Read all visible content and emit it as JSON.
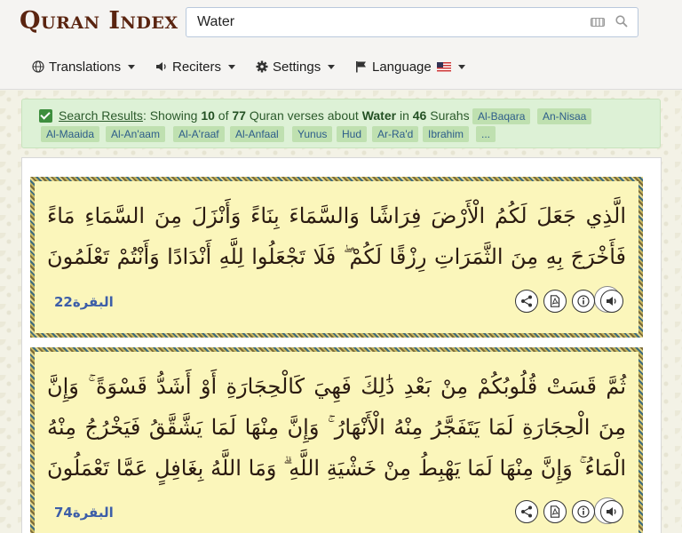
{
  "app": {
    "logo_text": "Quran Index"
  },
  "search": {
    "value": "Water"
  },
  "menu": {
    "translations": "Translations",
    "reciters": "Reciters",
    "settings": "Settings",
    "language": "Language"
  },
  "results": {
    "link_label": "Search Results",
    "prefix": ": Showing ",
    "shown": "10",
    "of": " of ",
    "total": "77",
    "mid": " Quran verses about ",
    "term": "Water",
    "in": " in ",
    "surah_count": "46",
    "suffix": " Surahs",
    "tags": [
      "Al-Baqara",
      "An-Nisaa",
      "Al-Maaida",
      "Al-An'aam",
      "Al-A'raaf",
      "Al-Anfaal",
      "Yunus",
      "Hud",
      "Ar-Ra'd",
      "Ibrahim",
      "..."
    ]
  },
  "verses": [
    {
      "text": "الَّذِي جَعَلَ لَكُمُ الْأَرْضَ فِرَاشًا وَالسَّمَاءَ بِنَاءً وَأَنْزَلَ مِنَ السَّمَاءِ مَاءً فَأَخْرَجَ بِهِ مِنَ الثَّمَرَاتِ رِزْقًا لَكُمْ ۖ فَلَا تَجْعَلُوا لِلَّهِ أَنْدَادًا وَأَنْتُمْ تَعْلَمُونَ",
      "number": "22",
      "surah": "البقرة",
      "ref_number": "22"
    },
    {
      "text": "ثُمَّ قَسَتْ قُلُوبُكُمْ مِنْ بَعْدِ ذَٰلِكَ فَهِيَ كَالْحِجَارَةِ أَوْ أَشَدُّ قَسْوَةً ۚ وَإِنَّ مِنَ الْحِجَارَةِ لَمَا يَتَفَجَّرُ مِنْهُ الْأَنْهَارُ ۚ وَإِنَّ مِنْهَا لَمَا يَشَّقَّقُ فَيَخْرُجُ مِنْهُ الْمَاءُ ۚ وَإِنَّ مِنْهَا لَمَا يَهْبِطُ مِنْ خَشْيَةِ اللَّهِ ۗ وَمَا اللَّهُ بِغَافِلٍ عَمَّا تَعْمَلُونَ",
      "number": "74",
      "surah": "البقرة",
      "ref_number": "74"
    }
  ],
  "icons": {
    "share": "share-icon",
    "pdf": "pdf-icon",
    "info": "info-icon",
    "audio": "speaker-icon"
  },
  "colors": {
    "logo": "#5a2410",
    "results_bg": "#ddf1d6",
    "tag_bg": "#bfe0b0",
    "tag_text": "#2d5d8a",
    "verse_bg": "#fbf6bb",
    "ref_text": "#3d5ea8"
  }
}
